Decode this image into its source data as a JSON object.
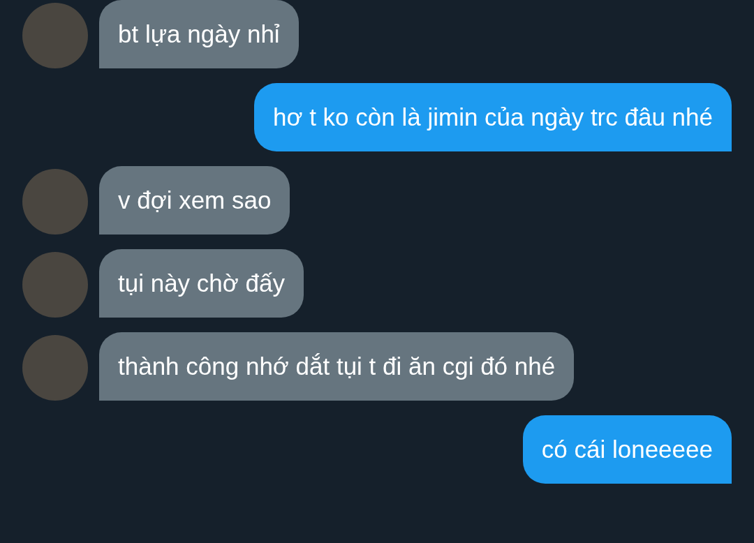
{
  "messages": [
    {
      "kind": "incoming",
      "text": "bt lựa ngày nhỉ"
    },
    {
      "kind": "outgoing",
      "text": "hơ t ko còn là jimin của ngày trc đâu nhé"
    },
    {
      "kind": "incoming",
      "text": "v đợi xem sao"
    },
    {
      "kind": "incoming",
      "text": "tụi này chờ đấy"
    },
    {
      "kind": "incoming",
      "text": "thành công nhớ dắt tụi t đi ăn cgi đó nhé"
    },
    {
      "kind": "outgoing",
      "text": "có cái loneeeee"
    }
  ]
}
